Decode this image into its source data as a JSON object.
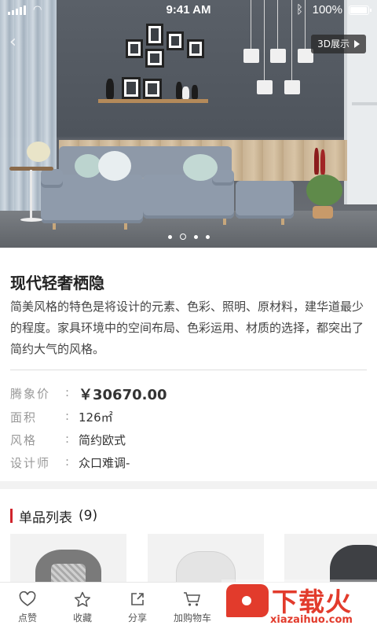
{
  "status_bar": {
    "time": "9:41 AM",
    "battery": "100%",
    "battery_level": 1.0
  },
  "hero": {
    "btn_3d": "3D展示",
    "carousel_total": 4,
    "carousel_active": 2
  },
  "product": {
    "title": "现代轻奢栖隐",
    "description": "简美风格的特色是将设计的元素、色彩、照明、原材料，建华道最少的程度。家具环境中的空间布局、色彩运用、材质的选择，都突出了简约大气的风格。",
    "attributes": [
      {
        "label": "腾象价",
        "colon": ":",
        "value": "￥30670.00"
      },
      {
        "label": "面积",
        "colon": ":",
        "value": "126㎡"
      },
      {
        "label": "风格",
        "colon": ":",
        "value": "简约欧式"
      },
      {
        "label": "设计师",
        "colon": ":",
        "value": "众口难调-"
      }
    ]
  },
  "items_section": {
    "title": "单品列表",
    "count": "(9)"
  },
  "bottom_bar": {
    "tabs": [
      {
        "label": "点赞",
        "icon": "heart-icon"
      },
      {
        "label": "收藏",
        "icon": "star-icon"
      },
      {
        "label": "分享",
        "icon": "share-icon"
      },
      {
        "label": "加购物车",
        "icon": "cart-icon"
      }
    ]
  },
  "watermark": {
    "text": "下载火",
    "url": "xiazaihuo.com"
  },
  "colors": {
    "accent": "#d0242c",
    "watermark": "#e23b2c"
  }
}
